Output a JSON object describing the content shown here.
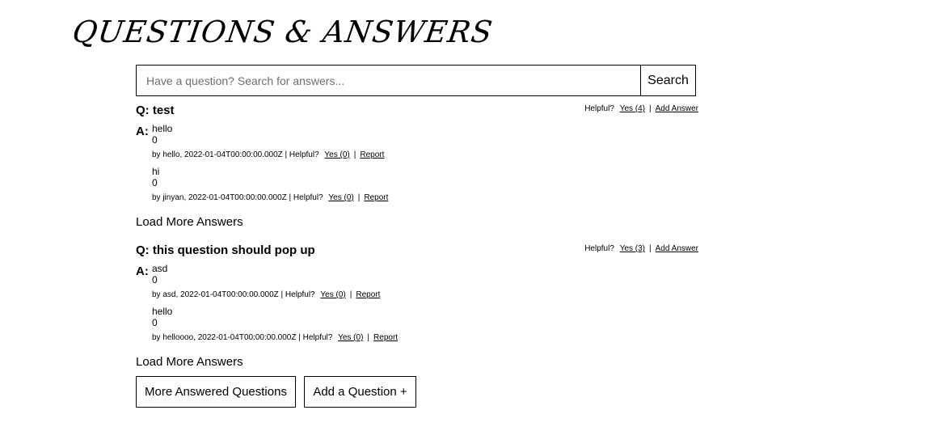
{
  "header": {
    "title": "QUESTIONS & ANSWERS"
  },
  "search": {
    "placeholder": "Have a question? Search for answers...",
    "button_label": "Search"
  },
  "questions": [
    {
      "text": "Q: test",
      "helpful_label": "Helpful?",
      "yes_label": "Yes (4)",
      "add_answer_label": "Add Answer",
      "answers_label": "A:",
      "answers": [
        {
          "body": "hello",
          "votes": "0",
          "meta": "by hello, 2022-01-04T00:00:00.000Z | Helpful?",
          "yes_label": "Yes (0)",
          "report_label": "Report"
        },
        {
          "body": "hi",
          "votes": "0",
          "meta": "by jinyan, 2022-01-04T00:00:00.000Z | Helpful?",
          "yes_label": "Yes (0)",
          "report_label": "Report"
        }
      ],
      "load_more_label": "Load More Answers"
    },
    {
      "text": "Q: this question should pop up",
      "helpful_label": "Helpful?",
      "yes_label": "Yes (3)",
      "add_answer_label": "Add Answer",
      "answers_label": "A:",
      "answers": [
        {
          "body": "asd",
          "votes": "0",
          "meta": "by asd, 2022-01-04T00:00:00.000Z | Helpful?",
          "yes_label": "Yes (0)",
          "report_label": "Report"
        },
        {
          "body": "hello",
          "votes": "0",
          "meta": "by helloooo, 2022-01-04T00:00:00.000Z | Helpful?",
          "yes_label": "Yes (0)",
          "report_label": "Report"
        }
      ],
      "load_more_label": "Load More Answers"
    }
  ],
  "footer": {
    "more_questions_label": "More Answered Questions",
    "add_question_label": "Add a Question +"
  }
}
